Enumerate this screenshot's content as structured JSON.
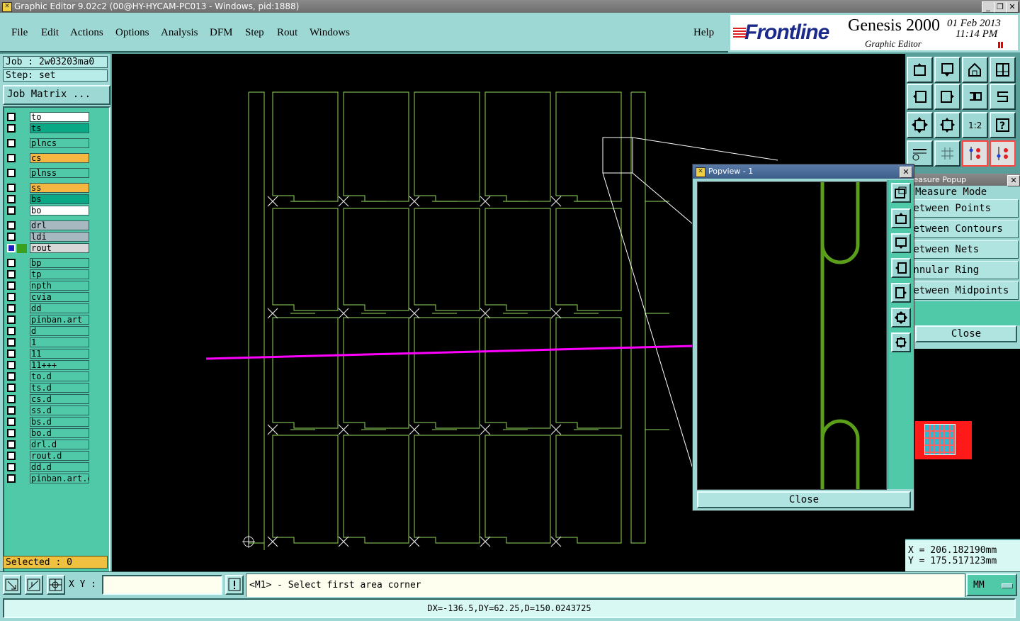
{
  "window": {
    "title": "Graphic Editor 9.02c2 (00@HY-HYCAM-PC013 - Windows, pid:1888)"
  },
  "menu": {
    "items": [
      "File",
      "Edit",
      "Actions",
      "Options",
      "Analysis",
      "DFM",
      "Step",
      "Rout",
      "Windows"
    ],
    "help": "Help"
  },
  "brand": {
    "logo": "Frontline",
    "product": "Genesis 2000",
    "subtitle": "Graphic Editor",
    "date": "01 Feb 2013",
    "time": "11:14 PM"
  },
  "job": {
    "job": "Job : 2w03203ma0",
    "step": "Step: set",
    "matrix_button": "Job Matrix ..."
  },
  "layers": [
    {
      "name": "to",
      "color": "#ffffff"
    },
    {
      "name": "ts",
      "color": "#0aa884"
    },
    {
      "name": "plncs",
      "color": "#4fc9a8"
    },
    {
      "name": "cs",
      "color": "#f5b642"
    },
    {
      "name": "plnss",
      "color": "#4fc9a8"
    },
    {
      "name": "ss",
      "color": "#f5b642"
    },
    {
      "name": "bs",
      "color": "#0aa884"
    },
    {
      "name": "bo",
      "color": "#ffffff"
    },
    {
      "name": "drl",
      "color": "#a8b8c0"
    },
    {
      "name": "ldi",
      "color": "#a8b8c0"
    },
    {
      "name": "rout",
      "color": "#d8d8d8"
    },
    {
      "name": "bp",
      "color": "#4fc9a8"
    },
    {
      "name": "tp",
      "color": "#4fc9a8"
    },
    {
      "name": "npth",
      "color": "#4fc9a8"
    },
    {
      "name": "cvia",
      "color": "#4fc9a8"
    },
    {
      "name": "dd",
      "color": "#4fc9a8"
    },
    {
      "name": "pinban.art",
      "color": "#4fc9a8"
    },
    {
      "name": "d",
      "color": "#4fc9a8"
    },
    {
      "name": "1",
      "color": "#4fc9a8"
    },
    {
      "name": "11",
      "color": "#4fc9a8"
    },
    {
      "name": "11+++",
      "color": "#4fc9a8"
    },
    {
      "name": "to.d",
      "color": "#4fc9a8"
    },
    {
      "name": "ts.d",
      "color": "#4fc9a8"
    },
    {
      "name": "cs.d",
      "color": "#4fc9a8"
    },
    {
      "name": "ss.d",
      "color": "#4fc9a8"
    },
    {
      "name": "bs.d",
      "color": "#4fc9a8"
    },
    {
      "name": "bo.d",
      "color": "#4fc9a8"
    },
    {
      "name": "drl.d",
      "color": "#4fc9a8"
    },
    {
      "name": "rout.d",
      "color": "#4fc9a8"
    },
    {
      "name": "dd.d",
      "color": "#4fc9a8"
    },
    {
      "name": "pinban.art.d",
      "color": "#4fc9a8"
    }
  ],
  "selected": "Selected : 0",
  "measure": {
    "title": "Measure Popup",
    "mode_label": "Measure Mode",
    "items": [
      "Between Points",
      "Between Contours",
      "Between Nets",
      "Annular Ring",
      "Between Midpoints"
    ],
    "close": "Close"
  },
  "popview": {
    "title": "Popview - 1",
    "close": "Close"
  },
  "coords": {
    "x": "X =  206.182190mm",
    "y": "Y =  175.517123mm"
  },
  "prompt": {
    "xy_label": "X Y :",
    "xy_value": "",
    "message": "<M1> - Select first area corner",
    "units": "MM"
  },
  "status": "DX=-136.5,DY=62.25,D=150.0243725",
  "colors": {
    "panel": "#9ed8d4",
    "rout_line": "#7ab04c",
    "measure_arrow": "#ff00ff",
    "popview_line": "#5a9e1a"
  }
}
